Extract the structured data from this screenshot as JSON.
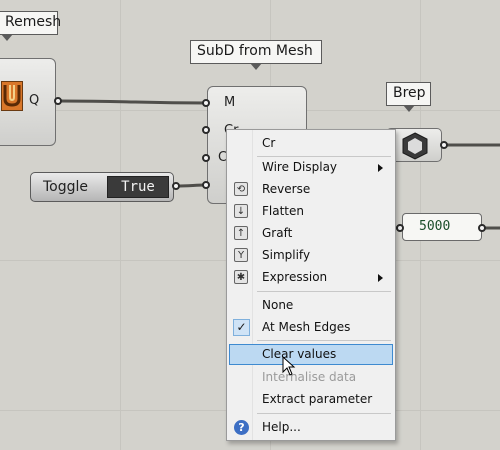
{
  "canvas": {
    "background": "#d3d2cc",
    "wire_color": "#4f4e4a"
  },
  "scribbles": {
    "remesh": "Remesh",
    "subd_from_mesh": "SubD from Mesh",
    "brep": "Brep"
  },
  "remesh_component": {
    "output_port": "Q"
  },
  "subd_component": {
    "inputs": [
      "M",
      "Cr",
      "Cr",
      ""
    ]
  },
  "toggle": {
    "label": "Toggle",
    "value": "True"
  },
  "number_slider": {
    "value": "5000"
  },
  "context_menu": {
    "header": "Cr",
    "items": [
      {
        "label": "Wire Display",
        "icon": "",
        "submenu": true
      },
      {
        "label": "Reverse",
        "icon": "reverse-icon"
      },
      {
        "label": "Flatten",
        "icon": "flatten-icon"
      },
      {
        "label": "Graft",
        "icon": "graft-icon"
      },
      {
        "label": "Simplify",
        "icon": "simplify-icon"
      },
      {
        "label": "Expression",
        "icon": "expression-icon",
        "submenu": true
      }
    ],
    "options": [
      {
        "label": "None",
        "checked": false
      },
      {
        "label": "At Mesh Edges",
        "checked": true
      }
    ],
    "actions": [
      {
        "label": "Clear values",
        "highlighted": true
      },
      {
        "label": "Internalise data",
        "disabled": true
      },
      {
        "label": "Extract parameter"
      }
    ],
    "help": "Help...",
    "highlight_color": "#bcd9f2"
  }
}
